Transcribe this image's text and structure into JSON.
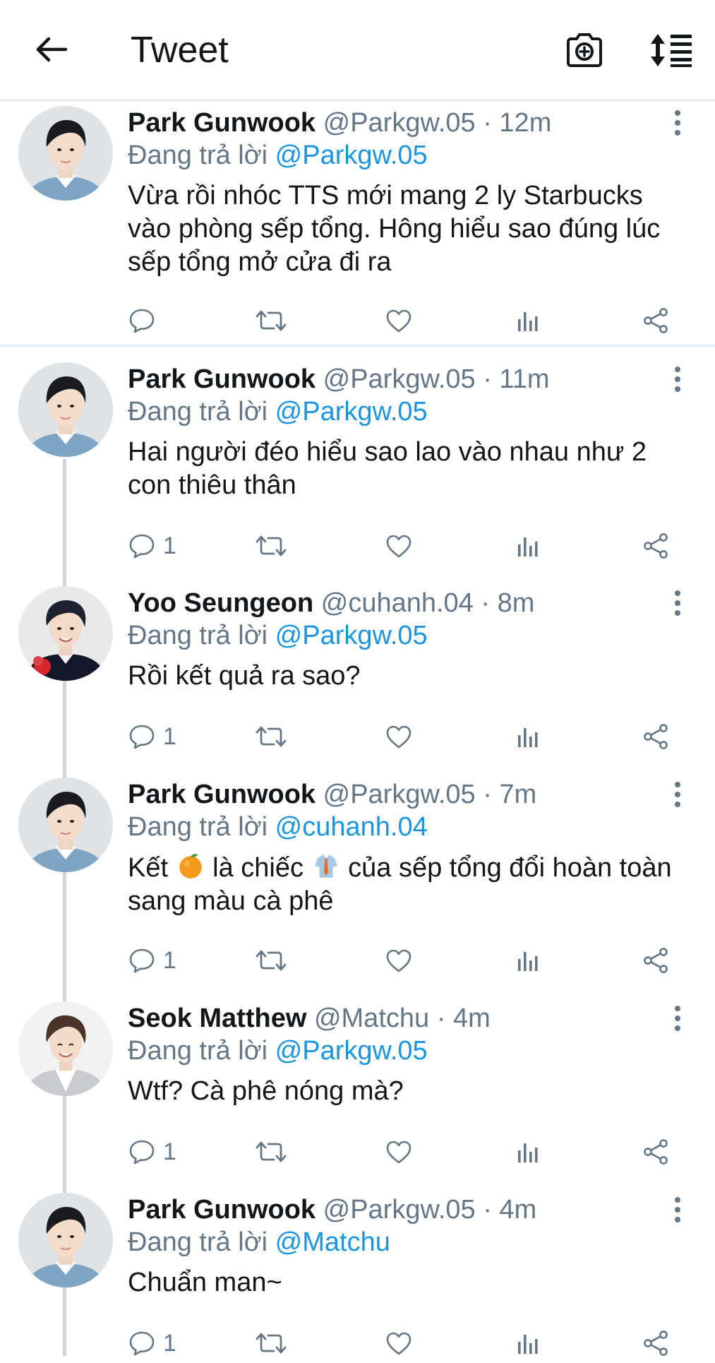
{
  "header": {
    "title": "Tweet",
    "back_icon": "back-arrow-icon",
    "camera_icon": "camera-add-icon",
    "sort_icon": "sort-icon"
  },
  "colors": {
    "accent": "#1b95e0",
    "muted": "#657786",
    "text": "#14171a",
    "divider": "#e6ecf0",
    "thread_line": "#cfd6dc"
  },
  "tweets": [
    {
      "name": "Park Gunwook",
      "handle": "@Parkgw.05",
      "time": "12m",
      "reply_prefix": "Đang trả lời",
      "reply_to": "@Parkgw.05",
      "text": "Vừa rồi nhóc TTS mới mang 2 ly Starbucks vào phòng sếp tổng. Hông hiểu sao đúng lúc sếp tổng mở cửa đi ra",
      "reply_count": ""
    },
    {
      "name": "Park Gunwook",
      "handle": "@Parkgw.05",
      "time": "11m",
      "reply_prefix": "Đang trả lời",
      "reply_to": "@Parkgw.05",
      "text": "Hai người đéo hiểu sao lao vào nhau như 2 con thiêu thân",
      "reply_count": "1"
    },
    {
      "name": "Yoo Seungeon",
      "handle": "@cuhanh.04",
      "time": "8m",
      "reply_prefix": "Đang trả lời",
      "reply_to": "@Parkgw.05",
      "text": "Rồi kết quả ra sao?",
      "reply_count": "1"
    },
    {
      "name": "Park Gunwook",
      "handle": "@Parkgw.05",
      "time": "7m",
      "reply_prefix": "Đang trả lời",
      "reply_to": "@cuhanh.04",
      "text_parts": [
        "Kết ",
        " là chiếc ",
        " của sếp tổng đổi hoàn toàn sang màu cà phê"
      ],
      "emojis": [
        "orange-emoji",
        "necktie-emoji"
      ],
      "reply_count": "1"
    },
    {
      "name": "Seok Matthew",
      "handle": "@Matchu",
      "time": "4m",
      "reply_prefix": "Đang trả lời",
      "reply_to": "@Parkgw.05",
      "text": "Wtf? Cà phê nóng mà?",
      "reply_count": "1"
    },
    {
      "name": "Park Gunwook",
      "handle": "@Parkgw.05",
      "time": "4m",
      "reply_prefix": "Đang trả lời",
      "reply_to": "@Matchu",
      "text": "Chuẩn man~",
      "reply_count": "1"
    }
  ],
  "separator": "·",
  "action_icons": [
    "reply-icon",
    "retweet-icon",
    "like-icon",
    "analytics-icon",
    "share-icon"
  ]
}
